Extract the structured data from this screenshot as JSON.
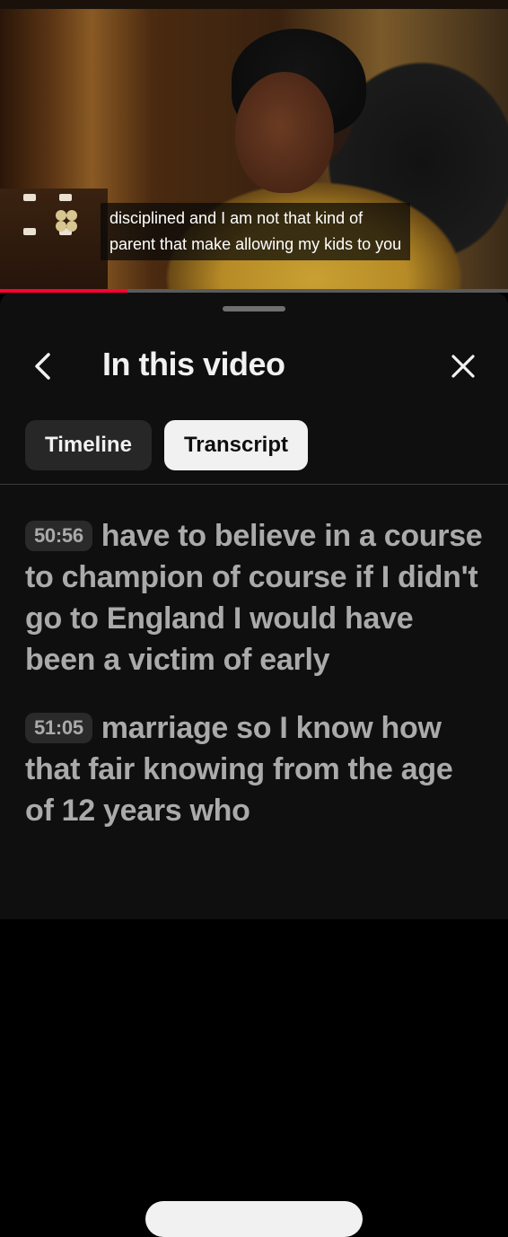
{
  "video": {
    "caption_lines": [
      "disciplined and I am not that kind of",
      "parent that make allowing my kids to you"
    ],
    "progress_fraction": 0.25,
    "progress_color": "#ff0033"
  },
  "panel": {
    "title": "In this video",
    "back_icon": "chevron-left-icon",
    "close_icon": "close-icon"
  },
  "tabs": [
    {
      "label": "Timeline",
      "active": false
    },
    {
      "label": "Transcript",
      "active": true
    }
  ],
  "transcript": [
    {
      "timestamp": "50:56",
      "text": "have to believe in a course to champion of course if I didn't go to England I would have been a victim of early"
    },
    {
      "timestamp": "51:05",
      "text": "marriage so I know how that fair knowing from the age of 12 years who"
    }
  ],
  "colors": {
    "sheet_background": "#0f0f0f",
    "active_tab": "#f1f1f1",
    "inactive_tab": "#272727",
    "transcript_text": "#aaaaaa"
  }
}
